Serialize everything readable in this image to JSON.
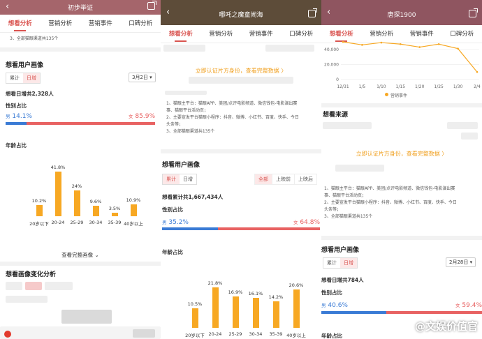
{
  "panels": [
    {
      "title": "初步举证",
      "tabs": [
        "想看分析",
        "营销分析",
        "营销事件",
        "口碑分析"
      ],
      "notes_tail": "3、全部猫眼渠道共135个",
      "portrait": {
        "title": "想看用户画像",
        "seg": [
          "累计",
          "日增"
        ],
        "date": "3月2日",
        "total_label": "想看日增共2,328人",
        "gender_title": "性别占比",
        "male_label": "男",
        "male_pct": "14.1%",
        "male_value": 14.1,
        "female_label": "女",
        "female_pct": "85.9%",
        "age_title": "年龄占比",
        "age": {
          "categories": [
            "20岁以下",
            "20-24",
            "25-29",
            "30-34",
            "35-39",
            "40岁以上"
          ],
          "values": [
            10.2,
            41.8,
            24,
            9.6,
            3.5,
            10.9
          ],
          "labels": [
            "10.2%",
            "41.8%",
            "24%",
            "9.6%",
            "3.5%",
            "10.9%"
          ]
        }
      },
      "more": "查看完整画像",
      "change_title": "想看画像变化分析"
    },
    {
      "title": "哪吒之魔童闹海",
      "tabs": [
        "想看分析",
        "营销分析",
        "营销事件",
        "口碑分析"
      ],
      "verify": "立即认证片方身份，查看完整数据 〉",
      "notes": [
        "1、猫眼主平台：猫眼APP、美团/点评电影频道、微信钱包-电影演出赛",
        "事、猫眼平台活动页；",
        "2、主要宣发平台猫眼小程序：抖音、微博、小红书、百度、快手、今日",
        "头条等；",
        "3、全部猫眼渠道共135个"
      ],
      "portrait": {
        "title": "想看用户画像",
        "seg": [
          "累计",
          "日增"
        ],
        "filter": [
          "全部",
          "上映前",
          "上映后"
        ],
        "total_label": "想看累计共1,667,434人",
        "gender_title": "性别占比",
        "male_label": "男",
        "male_pct": "35.2%",
        "male_value": 35.2,
        "female_label": "女",
        "female_pct": "64.8%",
        "age_title": "年龄占比",
        "age": {
          "categories": [
            "20岁以下",
            "20-24",
            "25-29",
            "30-34",
            "35-39",
            "40岁以上"
          ],
          "values": [
            10.5,
            21.8,
            16.9,
            16.1,
            14.2,
            20.6
          ],
          "labels": [
            "10.5%",
            "21.8%",
            "16.9%",
            "16.1%",
            "14.2%",
            "20.6%"
          ]
        }
      }
    },
    {
      "title": "唐探1900",
      "tabs": [
        "想看分析",
        "营销分析",
        "营销事件",
        "口碑分析"
      ],
      "trend": {
        "y_ticks": [
          "40,000",
          "20,000",
          "0"
        ],
        "x_ticks": [
          "12/31",
          "1/5",
          "1/10",
          "1/15",
          "1/20",
          "1/25",
          "1/30",
          "2/4"
        ],
        "legend": "营销事件"
      },
      "source_title": "想看来源",
      "verify": "立即认证片方身份，查看完整数据 〉",
      "notes": [
        "1、猫眼主平台：猫眼APP、美团/点评电影频道、微信钱包-电影演出赛",
        "事、猫眼平台活动页；",
        "2、主要宣发平台猫眼小程序：抖音、微博、小红书、百度、快手、今日",
        "头条等；",
        "3、全部猫眼渠道共135个"
      ],
      "portrait": {
        "title": "想看用户画像",
        "seg": [
          "累计",
          "日增"
        ],
        "date": "2月28日",
        "total_label": "想看日增共784人",
        "gender_title": "性别占比",
        "male_label": "男",
        "male_pct": "40.6%",
        "male_value": 40.6,
        "female_label": "女",
        "female_pct": "59.4%",
        "age_title": "年龄占比"
      },
      "watermark": "@文娱价值官"
    }
  ],
  "chart_data": [
    {
      "type": "bar",
      "categories": [
        "20岁以下",
        "20-24",
        "25-29",
        "30-34",
        "35-39",
        "40岁以上"
      ],
      "values": [
        10.2,
        41.8,
        24,
        9.6,
        3.5,
        10.9
      ],
      "title": "年龄占比"
    },
    {
      "type": "bar",
      "categories": [
        "20岁以下",
        "20-24",
        "25-29",
        "30-34",
        "35-39",
        "40岁以上"
      ],
      "values": [
        10.5,
        21.8,
        16.9,
        16.1,
        14.2,
        20.6
      ],
      "title": "年龄占比"
    },
    {
      "type": "line",
      "x": [
        "12/31",
        "1/5",
        "1/10",
        "1/15",
        "1/20",
        "1/25",
        "1/30",
        "2/4"
      ],
      "ylim": [
        0,
        40000
      ],
      "series": [
        {
          "name": "营销事件",
          "values": [
            50000,
            46000,
            49000,
            47000,
            43000,
            47000,
            41000,
            10000
          ]
        }
      ]
    }
  ]
}
